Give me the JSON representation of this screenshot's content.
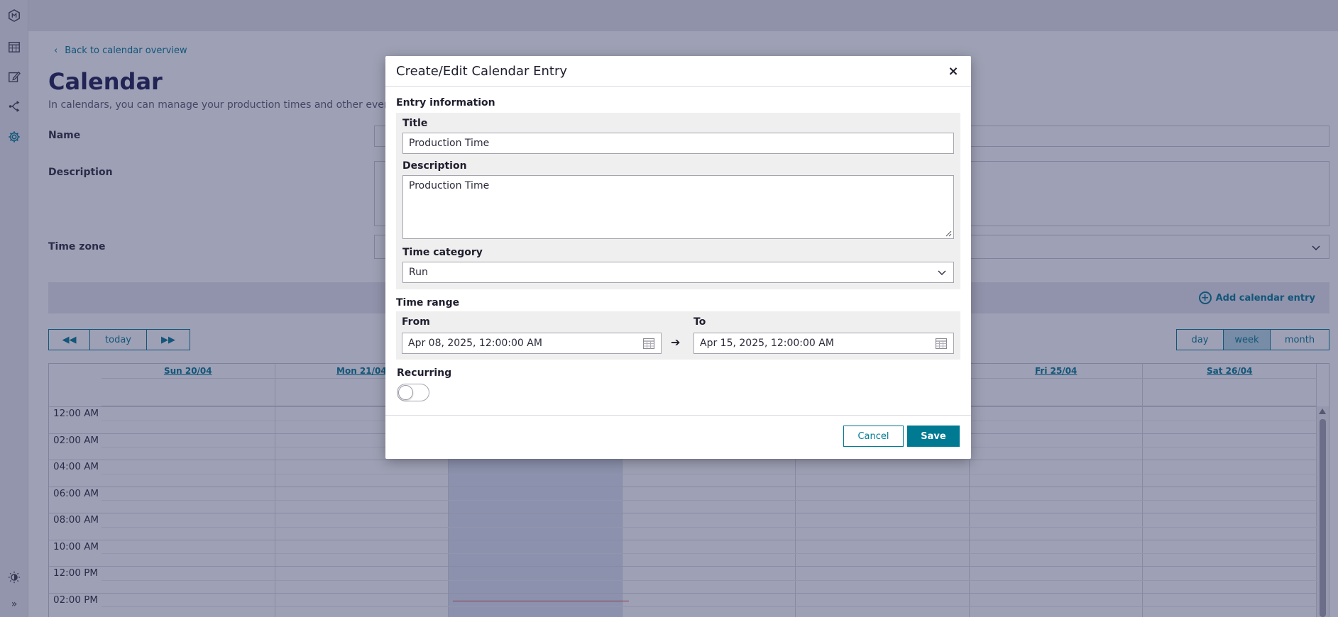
{
  "rail": {
    "icons": [
      "app-logo-icon",
      "calendar-grid-icon",
      "edit-icon",
      "share-flow-icon",
      "settings-gear-icon",
      "theme-toggle-icon",
      "expand-icon"
    ]
  },
  "page": {
    "back_link": "Back to calendar overview",
    "title": "Calendar",
    "subtitle": "In calendars, you can manage your production times and other events",
    "name_label": "Name",
    "description_label": "Description",
    "timezone_label": "Time zone",
    "add_entry": "Add calendar entry",
    "today_btn": "today",
    "views": [
      "day",
      "week",
      "month"
    ],
    "selected_view": "week",
    "days": [
      "Sun 20/04",
      "Mon 21/04",
      "",
      "",
      "",
      "Fri 25/04",
      "Sat 26/04"
    ],
    "times": [
      "12:00 AM",
      "02:00 AM",
      "04:00 AM",
      "06:00 AM",
      "08:00 AM",
      "10:00 AM",
      "12:00 PM",
      "02:00 PM"
    ]
  },
  "modal": {
    "title": "Create/Edit Calendar Entry",
    "close": "×",
    "entry_section": "Entry information",
    "title_label": "Title",
    "title_value": "Production Time",
    "description_label": "Description",
    "description_value": "Production Time",
    "time_category_label": "Time category",
    "time_category_value": "Run",
    "time_range_section": "Time range",
    "from_label": "From",
    "from_value": "Apr 08, 2025, 12:00:00 AM",
    "to_label": "To",
    "to_value": "Apr 15, 2025, 12:00:00 AM",
    "range_arrow": "➔",
    "recurring_label": "Recurring",
    "recurring_on": false,
    "cancel": "Cancel",
    "save": "Save"
  },
  "colors": {
    "accent": "#007993",
    "overlay": "#282c5a",
    "now_line": "#e04040"
  }
}
